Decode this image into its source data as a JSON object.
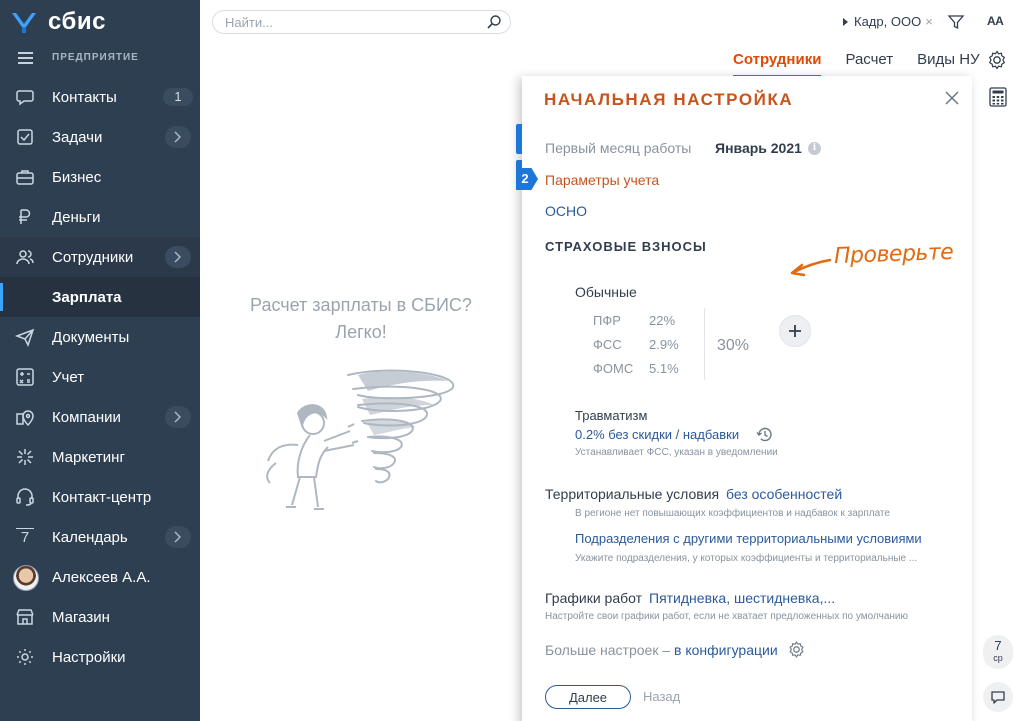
{
  "app": {
    "logo_text": "сбис",
    "enterprise_label": "ПРЕДПРИЯТИЕ"
  },
  "sidebar": {
    "items": [
      {
        "label": "Контакты",
        "icon": "chat-icon",
        "count": "1"
      },
      {
        "label": "Задачи",
        "icon": "task-icon"
      },
      {
        "label": "Бизнес",
        "icon": "briefcase-icon"
      },
      {
        "label": "Деньги",
        "icon": "money-icon"
      },
      {
        "label": "Сотрудники",
        "icon": "people-icon"
      },
      {
        "label": "Зарплата"
      },
      {
        "label": "Документы",
        "icon": "paper-plane-icon"
      },
      {
        "label": "Учет",
        "icon": "calculator-icon"
      },
      {
        "label": "Компании",
        "icon": "location-icon"
      },
      {
        "label": "Маркетинг",
        "icon": "burst-icon"
      },
      {
        "label": "Контакт-центр",
        "icon": "headset-icon"
      },
      {
        "label": "Календарь",
        "icon": "calendar-icon",
        "day": "7"
      },
      {
        "label": "Алексеев А.А.",
        "icon": "avatar"
      },
      {
        "label": "Магазин",
        "icon": "shop-icon"
      },
      {
        "label": "Настройки",
        "icon": "gear-icon"
      }
    ]
  },
  "topbar": {
    "search_placeholder": "Найти...",
    "company": "Кадр, ООО",
    "company_clear": "×",
    "font_size_label": "АА"
  },
  "tabs": [
    {
      "label": "Сотрудники",
      "active": true
    },
    {
      "label": "Расчет",
      "active": false
    },
    {
      "label": "Виды НУ",
      "active": false
    }
  ],
  "empty_state": {
    "line1": "Расчет зарплаты в СБИС?",
    "line2": "Легко!"
  },
  "panel": {
    "title": "НАЧАЛЬНАЯ НАСТРОЙКА",
    "first_month_label": "Первый месяц работы",
    "first_month_value": "Январь 2021",
    "step2_number": "2",
    "step2_label": "Параметры учета",
    "tax_system": "ОСНО",
    "insurance_title": "СТРАХОВЫЕ ВЗНОСЫ",
    "hint": "Проверьте",
    "ordinary_label": "Обычные",
    "rates": [
      {
        "name": "ПФР",
        "value": "22%"
      },
      {
        "name": "ФСС",
        "value": "2.9%"
      },
      {
        "name": "ФОМС",
        "value": "5.1%"
      }
    ],
    "rates_total": "30%",
    "trauma_label": "Травматизм",
    "trauma_value": "0.2% без скидки / надбавки",
    "trauma_note": "Устанавливает ФСС, указан в уведомлении",
    "territorial_label": "Территориальные условия",
    "territorial_value": "без особенностей",
    "territorial_note": "В регионе нет повышающих коэффициентов и надбавок к зарплате",
    "subdivisions_link": "Подразделения с другими территориальными условиями",
    "subdivisions_note": "Укажите подразделения, у которых коэффициенты и территориальные ...",
    "schedules_label": "Графики работ",
    "schedules_value": "Пятидневка, шестидневка,...",
    "schedules_note": "Настройте свои графики работ, если не хватает предложенных по умолчанию",
    "more_label": "Больше настроек –",
    "more_link": "в конфигурации",
    "next_button": "Далее",
    "back_button": "Назад"
  },
  "rail": {
    "day_number": "7",
    "day_name": "ср"
  },
  "colors": {
    "sidebar_bg": "#2F3F52",
    "accent_orange": "#E04A05",
    "panel_title": "#C8541C",
    "link_blue": "#2B5A9B",
    "step_blue": "#1E76D8",
    "hint_orange": "#E36A10"
  }
}
